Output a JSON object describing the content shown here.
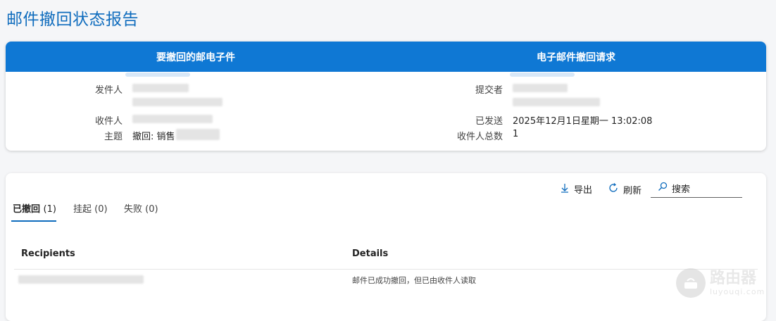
{
  "page_title": "邮件撤回状态报告",
  "top_card": {
    "left_header": "要撤回的邮电子件",
    "right_header": "电子邮件撤回请求",
    "left_rows": {
      "sender_label": "发件人",
      "recipient_label": "收件人",
      "subject_label": "主题",
      "subject_value": "撤回: 销售"
    },
    "right_rows": {
      "submitter_label": "提交者",
      "sent_label": "已发送",
      "sent_value": "2025年12月1日星期一 13:02:08",
      "total_label": "收件人总数",
      "total_value": "1"
    }
  },
  "toolbar": {
    "export_label": "导出",
    "refresh_label": "刷新",
    "search_placeholder": "搜索"
  },
  "tabs": [
    {
      "label": "已撤回",
      "count": "(1)"
    },
    {
      "label": "挂起",
      "count": "(0)"
    },
    {
      "label": "失败",
      "count": "(0)"
    }
  ],
  "table": {
    "headers": [
      "Recipients",
      "Details"
    ],
    "rows": [
      {
        "details": "邮件已成功撤回，但已由收件人读取"
      }
    ]
  },
  "watermark": {
    "main": "路由器",
    "sub": "luyouqi.com"
  },
  "colors": {
    "accent": "#0f78d4",
    "title": "#0f6cbd"
  }
}
